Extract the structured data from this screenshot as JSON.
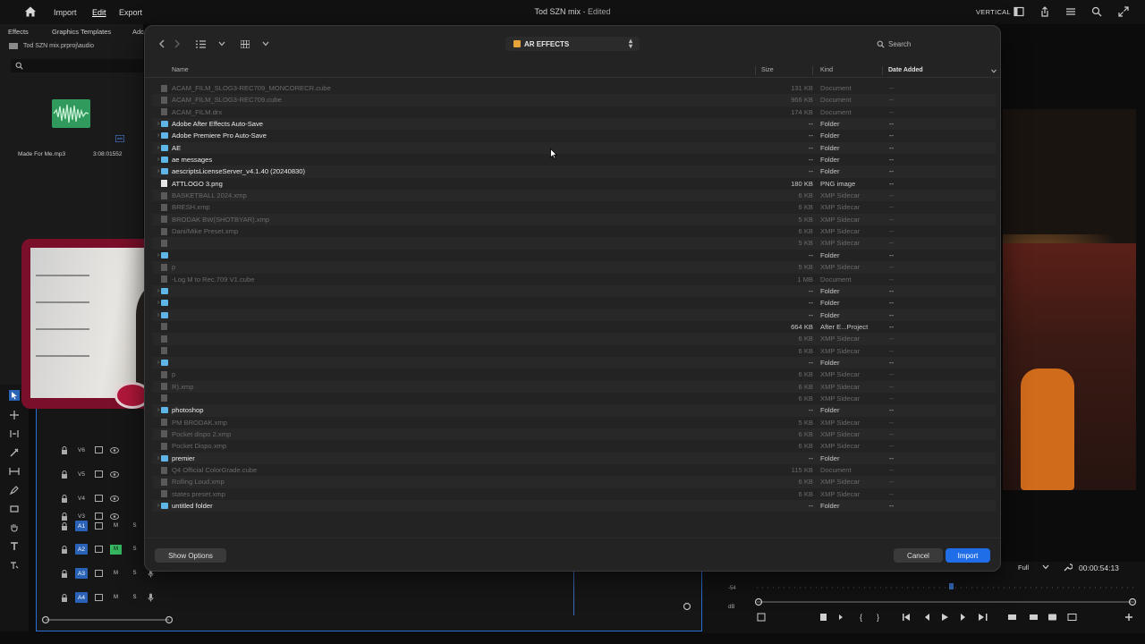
{
  "topbar": {
    "menu": [
      "Import",
      "Edit",
      "Export"
    ],
    "doc_name": "Tod SZN mix",
    "doc_status": "- Edited",
    "workspace": "VERTICAL"
  },
  "left_panel": {
    "tabs": [
      "Effects",
      "Graphics Templates",
      "Adc"
    ],
    "project_path": "Tod SZN mix.prproj\\audio",
    "clip_name": "Made For Me.mp3",
    "clip_duration": "3:08:01552"
  },
  "timeline": {
    "video_tracks": [
      "V6",
      "V5",
      "V4",
      "V3"
    ],
    "audio_tracks": [
      "A1",
      "A2",
      "A3",
      "A4"
    ],
    "mute_label": "M",
    "solo_label": "S"
  },
  "monitor": {
    "quality": "Full",
    "timecode": "00:00:54:13",
    "meter_label": "-54",
    "db_label": "dB"
  },
  "dialog": {
    "location": "AR EFFECTS",
    "search_placeholder": "Search",
    "columns": {
      "name": "Name",
      "size": "Size",
      "kind": "Kind",
      "date": "Date Added"
    },
    "files": [
      {
        "name": "ACAM_FILM_SLOG3-REC709_MONCORECR.cube",
        "size": "131 KB",
        "kind": "Document",
        "date": "--",
        "type": "doc",
        "enabled": false
      },
      {
        "name": "ACAM_FILM_SLOG3-REC709.cube",
        "size": "966 KB",
        "kind": "Document",
        "date": "--",
        "type": "doc",
        "enabled": false
      },
      {
        "name": "ACAM_FILM.drx",
        "size": "174 KB",
        "kind": "Document",
        "date": "--",
        "type": "doc",
        "enabled": false
      },
      {
        "name": "Adobe After Effects Auto-Save",
        "size": "--",
        "kind": "Folder",
        "date": "--",
        "type": "folder",
        "enabled": true
      },
      {
        "name": "Adobe Premiere Pro Auto-Save",
        "size": "--",
        "kind": "Folder",
        "date": "--",
        "type": "folder",
        "enabled": true
      },
      {
        "name": "AE",
        "size": "--",
        "kind": "Folder",
        "date": "--",
        "type": "folder",
        "enabled": true
      },
      {
        "name": "ae messages",
        "size": "--",
        "kind": "Folder",
        "date": "--",
        "type": "folder",
        "enabled": true
      },
      {
        "name": "aescriptsLicenseServer_v4.1.40 (20240830)",
        "size": "--",
        "kind": "Folder",
        "date": "--",
        "type": "folder",
        "enabled": true
      },
      {
        "name": "ATTLOGO 3.png",
        "size": "180 KB",
        "kind": "PNG image",
        "date": "--",
        "type": "png",
        "enabled": true
      },
      {
        "name": "BASKETBALL 2024.xmp",
        "size": "6 KB",
        "kind": "XMP Sidecar",
        "date": "--",
        "type": "doc",
        "enabled": false
      },
      {
        "name": "BRESH.xmp",
        "size": "6 KB",
        "kind": "XMP Sidecar",
        "date": "--",
        "type": "doc",
        "enabled": false
      },
      {
        "name": "BRODAK BW(SHOTBYAR).xmp",
        "size": "5 KB",
        "kind": "XMP Sidecar",
        "date": "--",
        "type": "doc",
        "enabled": false
      },
      {
        "name": "Dani/Mike Preset.xmp",
        "size": "6 KB",
        "kind": "XMP Sidecar",
        "date": "--",
        "type": "doc",
        "enabled": false
      },
      {
        "name": "",
        "size": "5 KB",
        "kind": "XMP Sidecar",
        "date": "--",
        "type": "doc",
        "enabled": false
      },
      {
        "name": "",
        "size": "--",
        "kind": "Folder",
        "date": "--",
        "type": "folder",
        "enabled": true
      },
      {
        "name": "p",
        "size": "5 KB",
        "kind": "XMP Sidecar",
        "date": "--",
        "type": "doc",
        "enabled": false
      },
      {
        "name": "-Log M to Rec.709 V1.cube",
        "size": "1 MB",
        "kind": "Document",
        "date": "--",
        "type": "doc",
        "enabled": false
      },
      {
        "name": "",
        "size": "--",
        "kind": "Folder",
        "date": "--",
        "type": "folder",
        "enabled": true
      },
      {
        "name": "",
        "size": "--",
        "kind": "Folder",
        "date": "--",
        "type": "folder",
        "enabled": true
      },
      {
        "name": "",
        "size": "--",
        "kind": "Folder",
        "date": "--",
        "type": "folder",
        "enabled": true
      },
      {
        "name": "",
        "size": "664 KB",
        "kind": "After E...Project",
        "date": "--",
        "type": "doc",
        "enabled": true
      },
      {
        "name": "",
        "size": "6 KB",
        "kind": "XMP Sidecar",
        "date": "--",
        "type": "doc",
        "enabled": false
      },
      {
        "name": "",
        "size": "6 KB",
        "kind": "XMP Sidecar",
        "date": "--",
        "type": "doc",
        "enabled": false
      },
      {
        "name": "",
        "size": "--",
        "kind": "Folder",
        "date": "--",
        "type": "folder",
        "enabled": true
      },
      {
        "name": "p",
        "size": "6 KB",
        "kind": "XMP Sidecar",
        "date": "--",
        "type": "doc",
        "enabled": false
      },
      {
        "name": "R).xmp",
        "size": "6 KB",
        "kind": "XMP Sidecar",
        "date": "--",
        "type": "doc",
        "enabled": false
      },
      {
        "name": "",
        "size": "6 KB",
        "kind": "XMP Sidecar",
        "date": "--",
        "type": "doc",
        "enabled": false
      },
      {
        "name": "photoshop",
        "size": "--",
        "kind": "Folder",
        "date": "--",
        "type": "folder",
        "enabled": true
      },
      {
        "name": "PM BRODAK.xmp",
        "size": "5 KB",
        "kind": "XMP Sidecar",
        "date": "--",
        "type": "doc",
        "enabled": false
      },
      {
        "name": "Pocket dispo 2.xmp",
        "size": "6 KB",
        "kind": "XMP Sidecar",
        "date": "--",
        "type": "doc",
        "enabled": false
      },
      {
        "name": "Pocket Dispo.xmp",
        "size": "6 KB",
        "kind": "XMP Sidecar",
        "date": "--",
        "type": "doc",
        "enabled": false
      },
      {
        "name": "premier",
        "size": "--",
        "kind": "Folder",
        "date": "--",
        "type": "folder",
        "enabled": true
      },
      {
        "name": "Q4 Official ColorGrade.cube",
        "size": "115 KB",
        "kind": "Document",
        "date": "--",
        "type": "doc",
        "enabled": false
      },
      {
        "name": "Rolling Loud.xmp",
        "size": "6 KB",
        "kind": "XMP Sidecar",
        "date": "--",
        "type": "doc",
        "enabled": false
      },
      {
        "name": "states preset.xmp",
        "size": "6 KB",
        "kind": "XMP Sidecar",
        "date": "--",
        "type": "doc",
        "enabled": false
      },
      {
        "name": "untitled folder",
        "size": "--",
        "kind": "Folder",
        "date": "--",
        "type": "folder",
        "enabled": true
      }
    ],
    "show_options_label": "Show Options",
    "cancel_label": "Cancel",
    "import_label": "Import"
  },
  "colors": {
    "accent": "#1f6ee8",
    "folder": "#5fb5e8",
    "location_folder": "#e8a23a",
    "audio_clip": "#2f9a5c",
    "webcam_frame": "#7a0f2a"
  }
}
